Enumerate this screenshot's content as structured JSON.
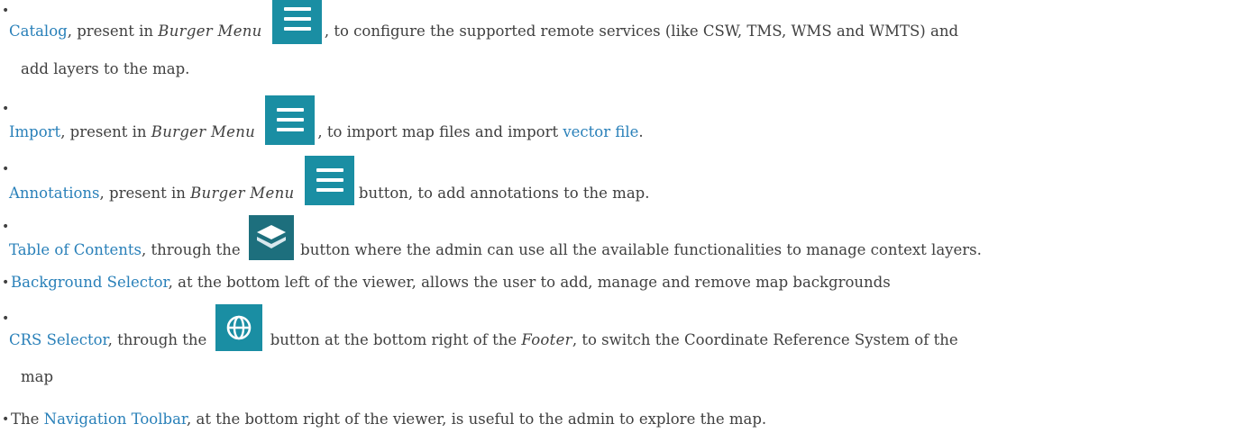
{
  "items": [
    {
      "link": "Catalog",
      "text_a": ", present in ",
      "em": "Burger Menu",
      "icon": "burger-menu-icon",
      "text_b": ", to configure the supported remote services (like CSW, TMS, WMS and WMTS) and",
      "text_c": "add layers to the map."
    },
    {
      "link": "Import",
      "text_a": ", present in ",
      "em": "Burger Menu",
      "icon": "burger-menu-icon",
      "text_b": ", to import map files and import ",
      "link2": "vector file",
      "text_c": "."
    },
    {
      "link": "Annotations",
      "text_a": ", present in ",
      "em": "Burger Menu",
      "icon": "burger-menu-icon",
      "text_b": " button, to add annotations to the map."
    },
    {
      "link": "Table of Contents",
      "text_a": ", through the ",
      "icon": "layers-icon",
      "text_b": " button where the admin can use all the available functionalities to manage context layers."
    },
    {
      "link": "Background Selector",
      "text_a": ", at the bottom left of the viewer, allows the user to add, manage and remove map backgrounds"
    },
    {
      "link": "CRS Selector",
      "text_a": ", through the ",
      "icon": "globe-icon",
      "text_b": " button at the bottom right of the ",
      "em": "Footer",
      "text_c": ", to switch the Coordinate Reference System of the",
      "text_d": "map"
    },
    {
      "text_pre": "The ",
      "link": "Navigation Toolbar",
      "text_a": ", at the bottom right of the viewer, is useful to the admin to explore the map."
    }
  ],
  "colors": {
    "link": "#2980b9",
    "button_bg": "#1a8ea3",
    "layers_bg": "#1d6f7d",
    "text": "#404040"
  }
}
